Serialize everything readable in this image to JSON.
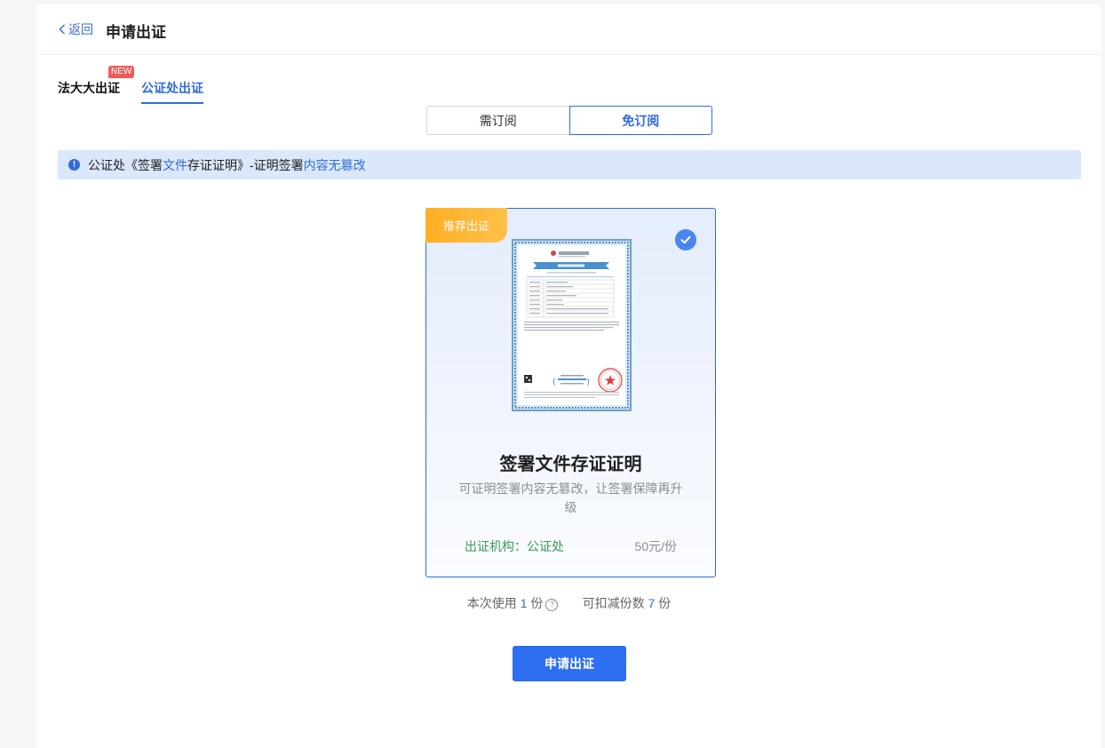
{
  "header": {
    "back_label": "返回",
    "title": "申请出证"
  },
  "tabs": [
    {
      "label": "法大大出证",
      "badge": "NEW"
    },
    {
      "label": "公证处出证"
    }
  ],
  "subscription": {
    "options": [
      "需订阅",
      "免订阅"
    ],
    "selected": "免订阅"
  },
  "notice": {
    "parts": [
      "公证处《签署",
      "文件",
      "存证证明》-证明签署",
      "内容无篡改"
    ]
  },
  "card": {
    "ribbon": "推荐出证",
    "title": "签署文件存证证明",
    "description": "可证明签署内容无篡改，让签署保障再升级",
    "org": "出证机构：公证处",
    "price": "50元/份",
    "selected": true
  },
  "usage": {
    "use_prefix": "本次使用",
    "use_count": "1",
    "use_unit": "份",
    "deduct_prefix": "可扣减份数",
    "deduct_count": "7",
    "deduct_unit": "份"
  },
  "submit_label": "申请出证",
  "colors": {
    "primary": "#2f6bdd",
    "ribbon": "#ffae24",
    "org": "#3a9a55",
    "badge": "#f05a5a"
  }
}
